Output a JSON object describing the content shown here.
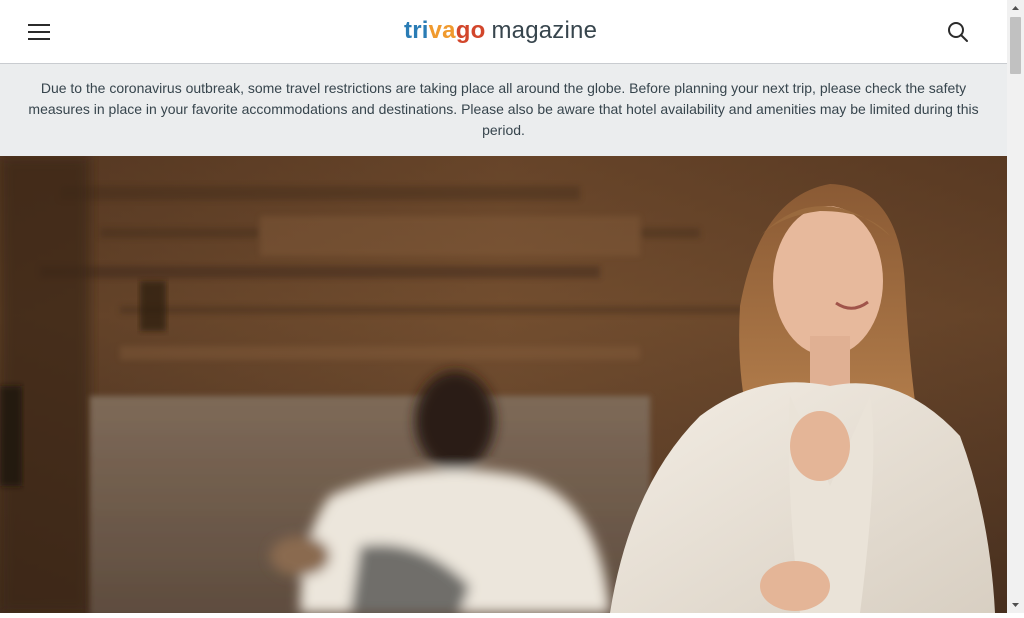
{
  "header": {
    "logo": {
      "part1": "tri",
      "part2": "va",
      "part3": "go",
      "part4": "magazine"
    },
    "menu_icon": "hamburger-icon",
    "search_icon": "search-icon"
  },
  "notice": {
    "text": "Due to the coronavirus outbreak, some travel restrictions are taking place all around the globe. Before planning your next trip, please check the safety measures in place in your favorite accommodations and destinations. Please also be aware that hotel availability and amenities may be limited during this period."
  },
  "hero": {
    "image": "photo of a smiling woman in a white bathrobe, man in bathrobe blurred in the background, wood-paneled room"
  },
  "colors": {
    "logo_blue": "#2a7cb5",
    "logo_orange": "#f09a2e",
    "logo_red": "#d2462b",
    "logo_gray": "#37454d",
    "notice_bg": "#ebedee"
  }
}
